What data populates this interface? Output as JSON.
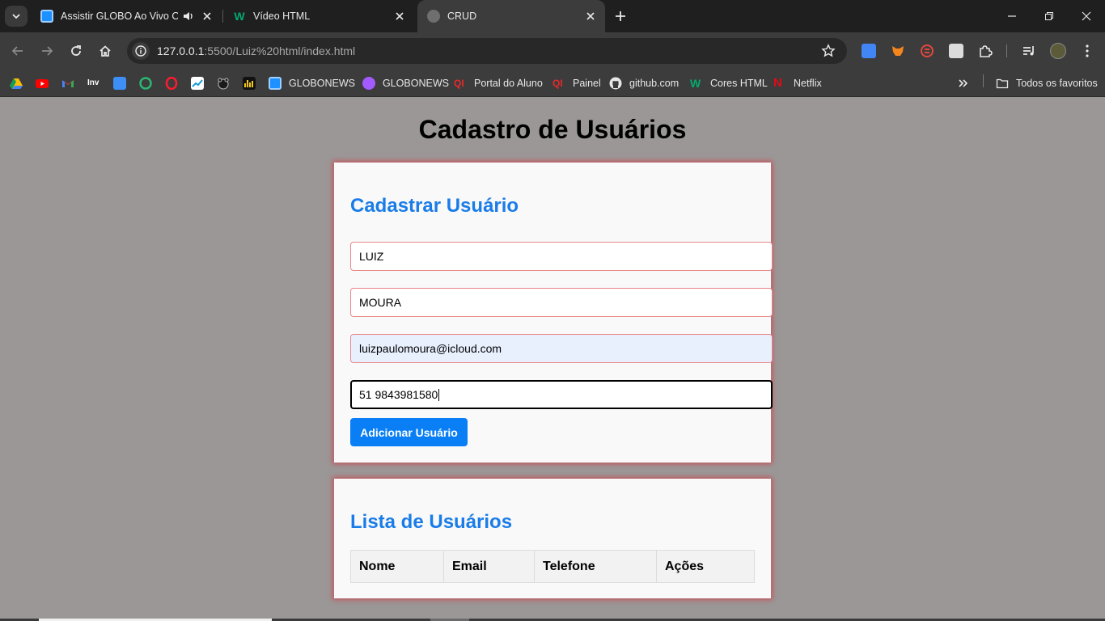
{
  "browser": {
    "tabs": [
      {
        "title": "Assistir GLOBO Ao Vivo Onl",
        "favicon": "tv-icon",
        "color": "#1e90ff",
        "audio": true
      },
      {
        "title": "Vídeo HTML",
        "favicon": "w3schools-icon",
        "color": "#04aa6d",
        "audio": false
      },
      {
        "title": "CRUD",
        "favicon": "globe-icon",
        "color": "#8a8a8a",
        "audio": false,
        "active": true
      }
    ],
    "address": {
      "host": "127.0.0.1",
      "rest": ":5500/Luiz%20html/index.html"
    },
    "extensions": [
      "google-translate-icon",
      "metamask-icon",
      "shield-extension-icon",
      "hand-extension-icon",
      "puzzle-icon",
      "media-control-icon",
      "profile-avatar",
      "kebab-menu-icon"
    ],
    "bookmarks": {
      "icon_only": [
        "google-drive-icon",
        "youtube-icon",
        "gmail-icon",
        "investing-icon",
        "video-icon",
        "sesc-icon",
        "opera-icon",
        "chart-icon",
        "bear-icon",
        "ludo-icon"
      ],
      "labeled": [
        {
          "label": "GLOBONEWS",
          "icon": "tv-icon",
          "color": "#1e90ff"
        },
        {
          "label": "GLOBONEWS",
          "icon": "globo-icon",
          "color": "#a35bff"
        },
        {
          "label": "Portal do Aluno",
          "icon": "portal-icon",
          "color": "#e62a2a"
        },
        {
          "label": "Painel",
          "icon": "painel-icon",
          "color": "#e62a2a"
        },
        {
          "label": "github.com",
          "icon": "github-icon",
          "color": "#e8e8e8"
        },
        {
          "label": "Cores HTML",
          "icon": "w3schools-icon",
          "color": "#04aa6d"
        },
        {
          "label": "Netflix",
          "icon": "netflix-icon",
          "color": "#e50914"
        }
      ],
      "all_bookmarks": "Todos os favoritos"
    }
  },
  "page": {
    "title": "Cadastro de Usuários",
    "form": {
      "heading": "Cadastrar Usuário",
      "first_name": "LUIZ",
      "last_name": "MOURA",
      "email": "luizpaulomoura@icloud.com",
      "phone": "51 9843981580",
      "submit_label": "Adicionar Usuário"
    },
    "list": {
      "heading": "Lista de Usuários",
      "columns": [
        "Nome",
        "Email",
        "Telefone",
        "Ações"
      ]
    },
    "colors": {
      "accent": "#0a7ff5",
      "heading": "#1a7ce8",
      "card_glow": "#c2575c",
      "background": "#9b9797"
    }
  }
}
